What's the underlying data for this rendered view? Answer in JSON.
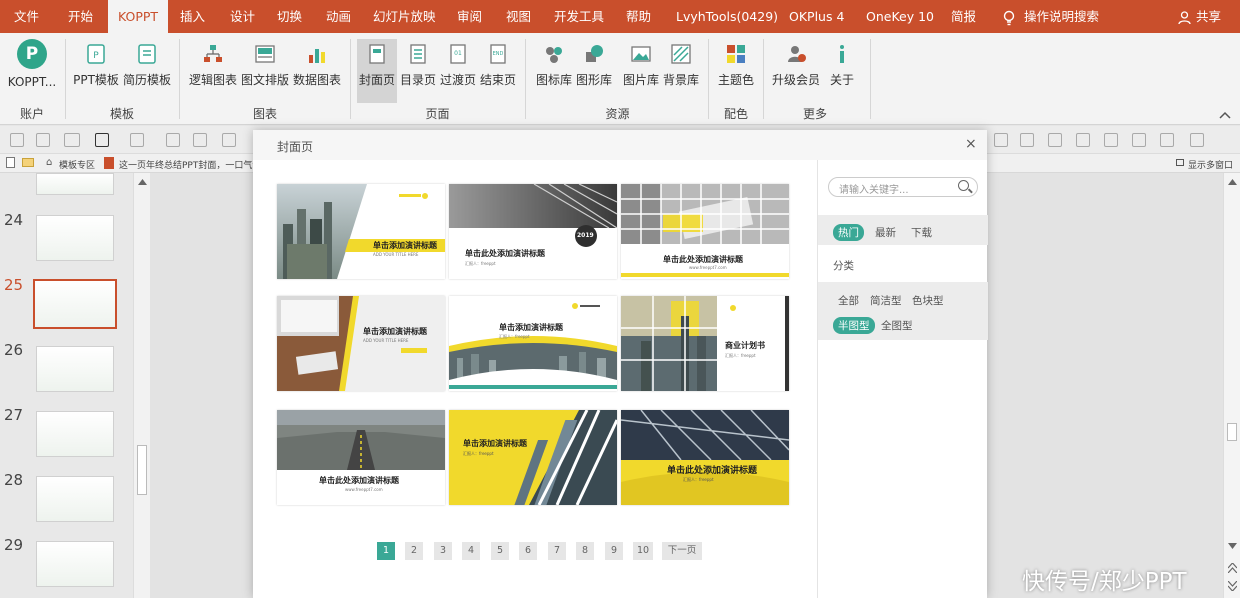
{
  "menubar": {
    "tabs": [
      "文件",
      "开始",
      "KOPPT",
      "插入",
      "设计",
      "切换",
      "动画",
      "幻灯片放映",
      "审阅",
      "视图",
      "开发工具",
      "帮助",
      "LvyhTools(0429)",
      "OKPlus 4",
      "OneKey 10",
      "简报"
    ],
    "active_tab": "KOPPT",
    "search_label": "操作说明搜索",
    "share_label": "共享"
  },
  "ribbon": {
    "account_label": "KOPPT...",
    "groups": {
      "account": "账户",
      "template": "模板",
      "chart": "图表",
      "page": "页面",
      "resource": "资源",
      "color": "配色",
      "more": "更多"
    },
    "buttons": {
      "ppt_template": "PPT模板",
      "resume_template": "简历模板",
      "logic_chart": "逻辑图表",
      "image_layout": "图文排版",
      "data_chart": "数据图表",
      "cover_page": "封面页",
      "toc_page": "目录页",
      "transition_page": "过渡页",
      "end_page": "结束页",
      "icon_lib": "图标库",
      "shape_lib": "图形库",
      "picture_lib": "图片库",
      "background_lib": "背景库",
      "theme_color": "主题色",
      "upgrade": "升级会员",
      "about": "关于"
    }
  },
  "tabbar": {
    "tab1": "模板专区",
    "tab2": "这一页年终总结PPT封面，一口气设计了",
    "restore": "显示多窗口"
  },
  "slides": {
    "numbers": [
      "24",
      "25",
      "26",
      "27",
      "28",
      "29"
    ],
    "active": "25"
  },
  "dialog": {
    "title": "封面页",
    "close_glyph": "×",
    "search_placeholder": "请输入关键字...",
    "sort_tabs": [
      "热门",
      "最新",
      "下载"
    ],
    "active_sort": "热门",
    "category_label": "分类",
    "categories": [
      "全部",
      "简洁型",
      "色块型",
      "半图型",
      "全图型"
    ],
    "active_category": "半图型",
    "cards": [
      {
        "title": "单击添加演讲标题",
        "sub": "ADD YOUR TITLE HERE"
      },
      {
        "title": "单击此处添加演讲标题",
        "badge": "2019",
        "sub": "汇报人：freeppt"
      },
      {
        "title": "单击此处添加演讲标题",
        "sub": "www.freeppt7.com"
      },
      {
        "title": "单击添加演讲标题",
        "sub": "ADD YOUR TITLE HERE"
      },
      {
        "title": "单击添加演讲标题",
        "sub": "汇报人：freeppt"
      },
      {
        "title": "商业计划书",
        "sub": "汇报人：freeppt"
      },
      {
        "title": "单击此处添加演讲标题",
        "sub": "www.freeppt7.com"
      },
      {
        "title": "单击添加演讲标题",
        "sub": "汇报人：freeppt"
      },
      {
        "title": "单击此处添加演讲标题",
        "sub": "汇报人：freeppt"
      }
    ],
    "pagination": [
      "1",
      "2",
      "3",
      "4",
      "5",
      "6",
      "7",
      "8",
      "9",
      "10"
    ],
    "active_page": "1",
    "next_label": "下一页"
  },
  "watermark": "快传号/郑少PPT",
  "colors": {
    "accent_red": "#c94f2c",
    "accent_teal": "#3aa896",
    "yellow": "#f1d92c"
  }
}
